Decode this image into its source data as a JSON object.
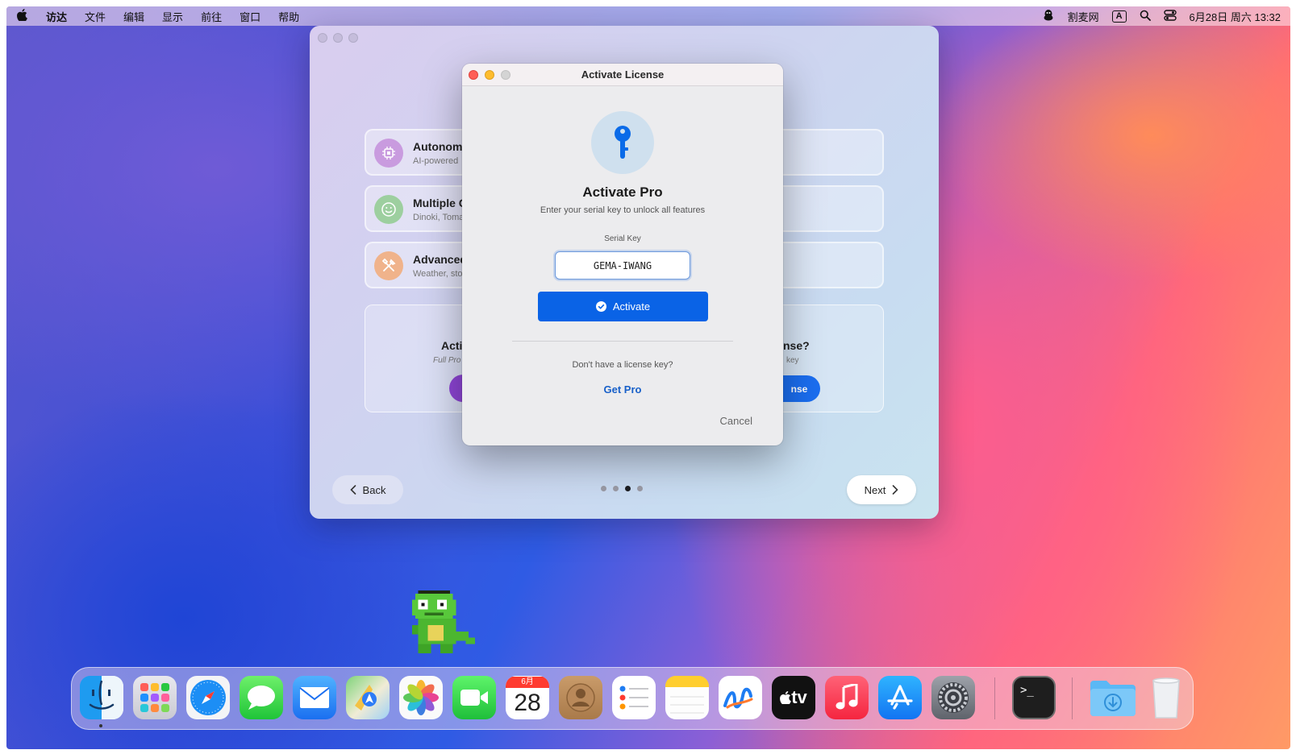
{
  "menubar": {
    "apple": "",
    "items": [
      "访达",
      "文件",
      "编辑",
      "显示",
      "前往",
      "窗口",
      "帮助"
    ],
    "status": {
      "app_name": "割麦网",
      "input_method": "A",
      "datetime": "6月28日 周六 13:32"
    }
  },
  "onboarding": {
    "features": [
      {
        "title": "Autonome",
        "subtitle": "AI-powered",
        "color": "#c99bdf"
      },
      {
        "title": "Multiple C",
        "subtitle": "Dinoki, Toma",
        "color": "#9dcf9f"
      },
      {
        "title": "Advanced",
        "subtitle": "Weather, sto",
        "color": "#f0b38b"
      }
    ],
    "left_card": {
      "title": "Acti",
      "subtitle": "Full Pro"
    },
    "right_card": {
      "title": "nse?",
      "subtitle": "key",
      "button": "nse"
    },
    "back_label": "Back",
    "next_label": "Next",
    "pager": {
      "count": 4,
      "active_index": 2
    }
  },
  "dialog": {
    "window_title": "Activate License",
    "heading": "Activate Pro",
    "subtitle": "Enter your serial key to unlock all features",
    "field_label": "Serial Key",
    "serial_value": "GEMA-IWANG",
    "activate_label": "Activate",
    "no_license": "Don't have a license key?",
    "get_pro": "Get Pro",
    "cancel": "Cancel",
    "accent": "#0a63e6"
  },
  "dock": {
    "apps": [
      {
        "name": "Finder",
        "icon": "finder-icon"
      },
      {
        "name": "Launchpad",
        "icon": "launchpad-icon"
      },
      {
        "name": "Safari",
        "icon": "safari-icon"
      },
      {
        "name": "Messages",
        "icon": "messages-icon"
      },
      {
        "name": "Mail",
        "icon": "mail-icon"
      },
      {
        "name": "Maps",
        "icon": "maps-icon"
      },
      {
        "name": "Photos",
        "icon": "photos-icon"
      },
      {
        "name": "FaceTime",
        "icon": "facetime-icon"
      },
      {
        "name": "Calendar",
        "icon": "calendar-icon",
        "month": "6月",
        "day": "28"
      },
      {
        "name": "Contacts",
        "icon": "contacts-icon"
      },
      {
        "name": "Reminders",
        "icon": "reminders-icon"
      },
      {
        "name": "Notes",
        "icon": "notes-icon"
      },
      {
        "name": "Freeform",
        "icon": "freeform-icon"
      },
      {
        "name": "TV",
        "icon": "tv-icon",
        "label": "tv"
      },
      {
        "name": "Music",
        "icon": "music-icon"
      },
      {
        "name": "App Store",
        "icon": "app-store-icon"
      },
      {
        "name": "System Settings",
        "icon": "settings-icon"
      },
      {
        "name": "Terminal",
        "icon": "terminal-icon",
        "label": ">_"
      },
      {
        "name": "Downloads",
        "icon": "downloads-folder-icon"
      },
      {
        "name": "Trash",
        "icon": "trash-icon"
      }
    ]
  }
}
